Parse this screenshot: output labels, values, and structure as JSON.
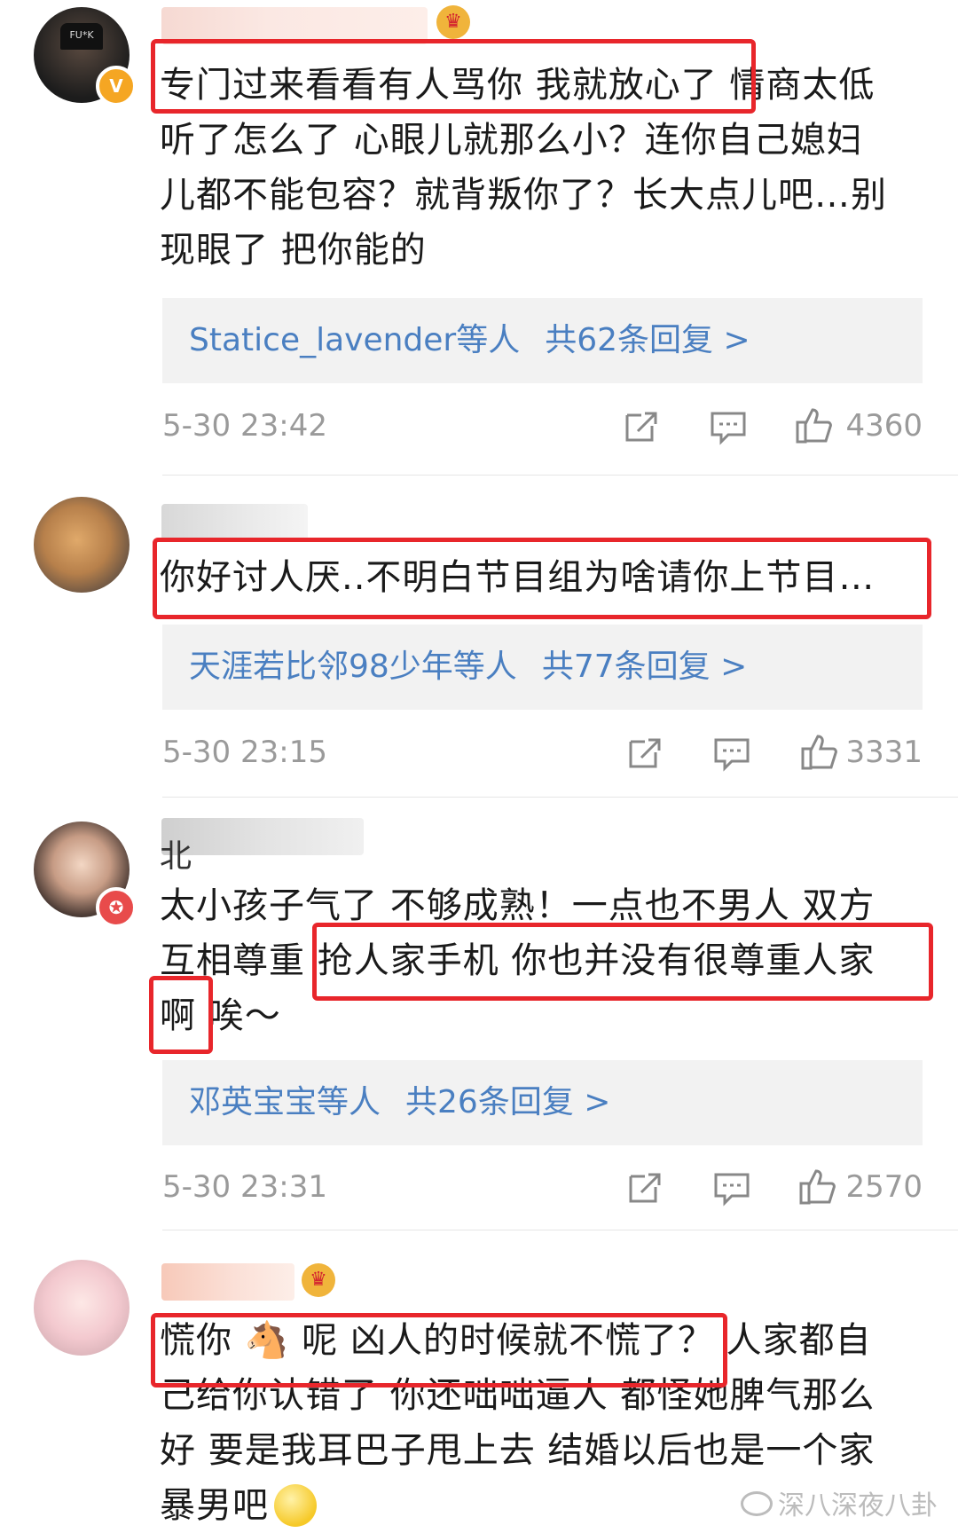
{
  "comments": [
    {
      "body_lines": [
        "专门过来看看有人骂你 我就放心了 情商太低",
        "听了怎么了 心眼儿就那么小？连你自己媳妇",
        "儿都不能包容？就背叛你了？长大点儿吧…别",
        "现眼了 把你能的"
      ],
      "reply_users": "Statice_lavender等人",
      "reply_count": "共62条回复 >",
      "time": "5-30 23:42",
      "likes": "4360"
    },
    {
      "body_lines": [
        "你好讨人厌..不明白节目组为啥请你上节目…"
      ],
      "reply_users": "天涯若比邻98少年等人",
      "reply_count": "共77条回复 >",
      "time": "5-30 23:15",
      "likes": "3331"
    },
    {
      "username_partial": "北",
      "body_lines": [
        "太小孩子气了 不够成熟！一点也不男人 双方",
        "互相尊重 抢人家手机 你也并没有很尊重人家",
        "啊 唉～"
      ],
      "reply_users": "邓英宝宝等人",
      "reply_count": "共26条回复 >",
      "time": "5-30 23:31",
      "likes": "2570"
    },
    {
      "body_lines": [
        "慌你 🐴 呢 凶人的时候就不慌了？ 人家都自",
        "己给你认错了 你还咄咄逼人 都怪她脾气那么",
        "好 要是我耳巴子甩上去 结婚以后也是一个家",
        "暴男吧"
      ]
    }
  ],
  "watermark": "深八深夜八卦",
  "colors": {
    "highlight": "#e8262b",
    "link": "#4a7fc1",
    "meta": "#9a9a9a",
    "reply_bg": "#f2f2f2"
  },
  "icons": [
    "share-icon",
    "comment-icon",
    "like-icon",
    "verified-icon",
    "crown-icon",
    "wechat-icon"
  ]
}
